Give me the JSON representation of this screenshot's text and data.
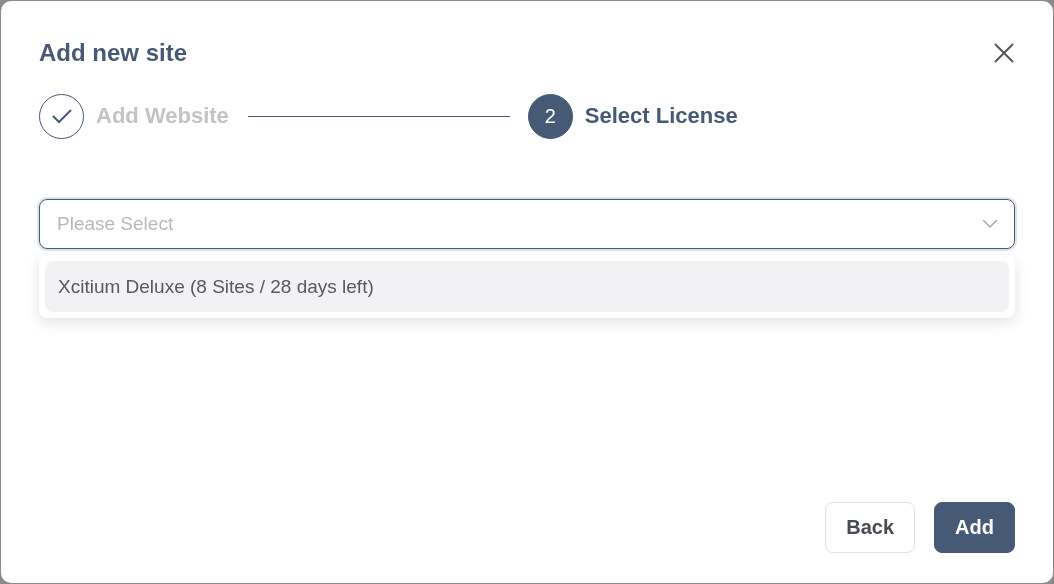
{
  "dialog": {
    "title": "Add new site"
  },
  "steps": [
    {
      "label": "Add Website",
      "completed": true,
      "selected": false
    },
    {
      "label": "Select License",
      "number": "2",
      "completed": false,
      "selected": true
    }
  ],
  "license_select": {
    "placeholder": "Please Select",
    "expanded": true,
    "options": [
      {
        "label": "Xcitium Deluxe (8 Sites / 28 days left)",
        "highlighted": true
      }
    ]
  },
  "buttons": [
    {
      "label": "Back",
      "kind": "secondary"
    },
    {
      "label": "Add",
      "kind": "primary"
    }
  ]
}
